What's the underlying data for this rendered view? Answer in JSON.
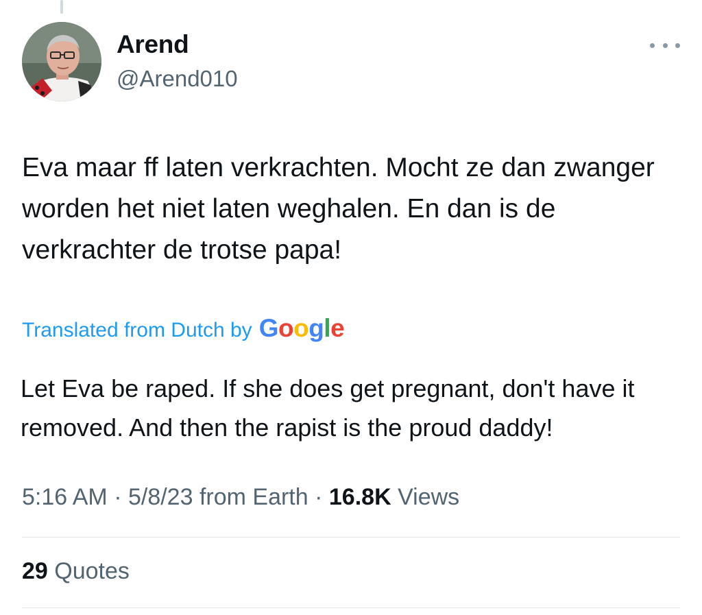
{
  "author": {
    "name": "Arend",
    "handle": "@Arend010"
  },
  "more_icon": "more-horizontal-icon",
  "tweet": {
    "text": "Eva maar ff laten verkrachten. Mocht ze dan zwanger worden het niet laten weghalen. En dan is de verkrachter de trotse papa!"
  },
  "translation": {
    "label": "Translated from Dutch by",
    "provider_letters": [
      "G",
      "o",
      "o",
      "g",
      "l",
      "e"
    ],
    "text": "Let Eva be raped. If she does get pregnant, don't have it removed. And then the rapist is the proud daddy!"
  },
  "meta": {
    "time": "5:16 AM",
    "separator": " · ",
    "date": "5/8/23",
    "source": " from Earth",
    "separator2": " · ",
    "views_count": "16.8K",
    "views_label": " Views"
  },
  "stats": {
    "quotes_count": "29",
    "quotes_label": " Quotes"
  },
  "colors": {
    "link": "#1d9bf0",
    "secondary_text": "#536471",
    "primary_text": "#0f1419",
    "google_blue": "#4285F4",
    "google_red": "#EA4335",
    "google_yellow": "#FBBC05",
    "google_green": "#34A853"
  }
}
